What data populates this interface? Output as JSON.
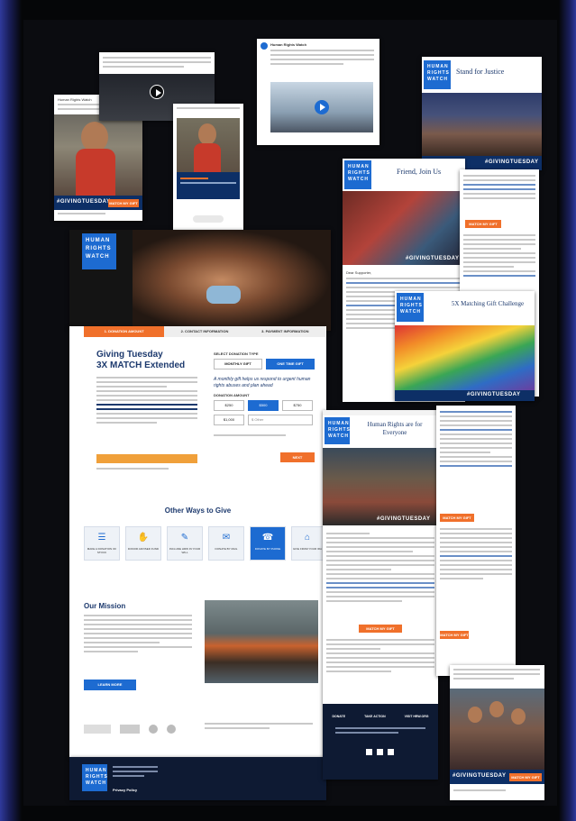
{
  "brand": {
    "logo_lines": [
      "HUMAN",
      "RIGHTS",
      "WATCH"
    ],
    "blue": "#1d6bd1",
    "orange": "#f0702b"
  },
  "giving_tuesday_tag": "#GIVINGTUESDAY",
  "social_post_1": {
    "account": "Human Rights Watch",
    "cta": "MATCH MY GIFT"
  },
  "social_post_3": {
    "account": "Human Rights Watch"
  },
  "email_stand": {
    "title": "Stand for Justice"
  },
  "email_friend": {
    "title": "Friend, Join Us",
    "greeting": "Dear Supporter,",
    "button": "MATCH MY GIFT"
  },
  "email_5x": {
    "title": "5X Matching Gift Challenge"
  },
  "email_everyone": {
    "title": "Human Rights are for Everyone",
    "button": "MATCH MY GIFT",
    "footer_links": [
      "DONATE",
      "TAKE ACTION",
      "VISIT HRW.ORG"
    ]
  },
  "donation_page": {
    "steps": [
      "1. DONATION AMOUNT",
      "2. CONTACT INFORMATION",
      "3. PAYMENT INFORMATION"
    ],
    "title_line1": "Giving Tuesday",
    "title_line2": "3X MATCH Extended",
    "frequency_label": "SELECT DONATION TYPE",
    "monthly": "MONTHLY GIFT",
    "one_time": "ONE TIME GIFT",
    "monthly_note": "A monthly gift helps us respond to urgent human rights abuses and plan ahead",
    "amount_label": "DONATION AMOUNT",
    "amounts": [
      "$250",
      "$500",
      "$750",
      "$1,000",
      "$ Other"
    ],
    "next": "NEXT",
    "other_ways_title": "Other Ways to Give",
    "other_ways": [
      "MAKE A DONATION OF STOCK",
      "DONOR ADVISED FUND",
      "INCLUDE HRW IN YOUR WILL",
      "DONATE BY MAIL",
      "DONATE BY PHONE",
      "GIVE FROM YOUR IRA"
    ],
    "mission_title": "Our Mission",
    "learn_more": "LEARN MORE",
    "footer_links": [
      "Privacy Policy"
    ]
  },
  "mobile_post": {
    "cta": "MATCH MY GIFT"
  }
}
